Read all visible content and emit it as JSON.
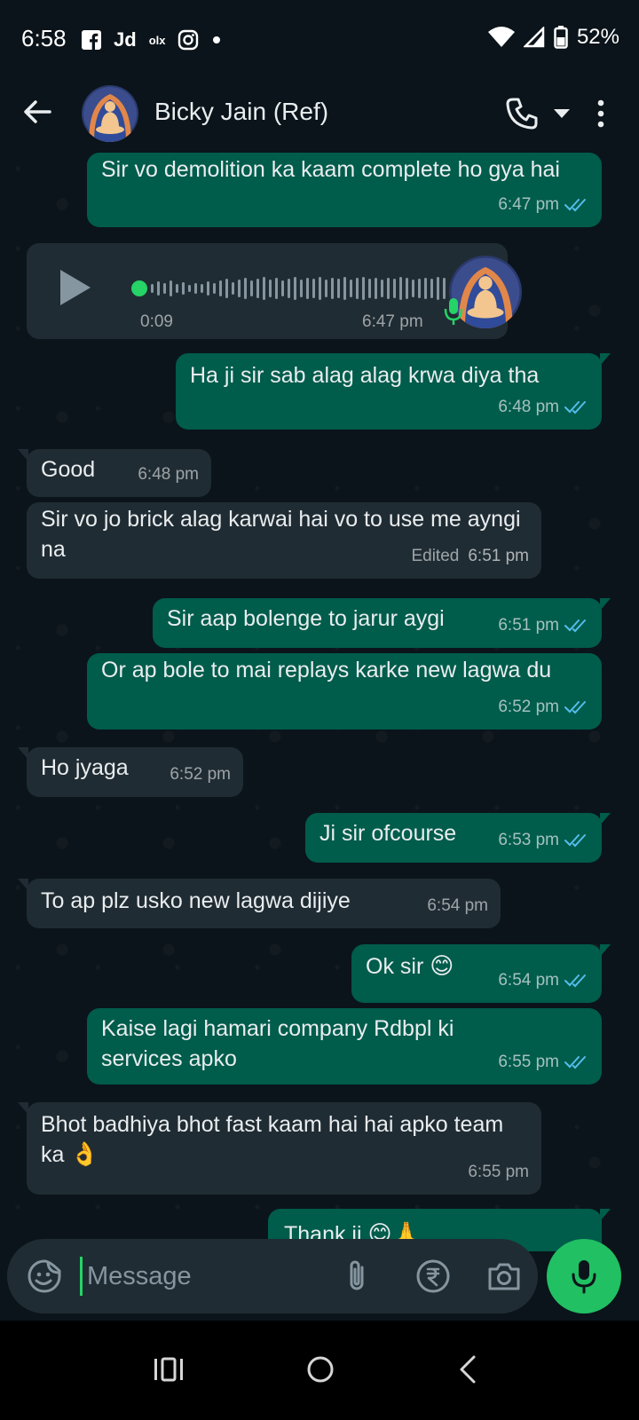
{
  "status_bar": {
    "time": "6:58",
    "app_icons": [
      "facebook-icon",
      "jd-icon",
      "olx-icon",
      "instagram-icon",
      "dot-icon"
    ],
    "jd_label": "Jd",
    "olx_label": "olx",
    "battery": "52%"
  },
  "header": {
    "contact_name": "Bicky Jain (Ref)"
  },
  "messages": [
    {
      "dir": "out",
      "text": "Sir vo demolition ka kaam complete ho gya hai",
      "time": "6:47 pm"
    },
    {
      "dir": "in",
      "type": "voice",
      "duration": "0:09",
      "time": "6:47 pm"
    },
    {
      "dir": "out",
      "text": "Ha ji  sir sab alag alag krwa diya tha",
      "time": "6:48 pm"
    },
    {
      "dir": "in",
      "text": "Good",
      "time": "6:48 pm"
    },
    {
      "dir": "in",
      "text": "Sir vo jo brick alag karwai hai vo to use me ayngi na",
      "edited": "Edited",
      "time": "6:51 pm"
    },
    {
      "dir": "out",
      "text": "Sir aap bolenge to jarur aygi",
      "time": "6:51 pm"
    },
    {
      "dir": "out",
      "text": "Or ap bole to mai replays karke new lagwa du",
      "time": "6:52 pm"
    },
    {
      "dir": "in",
      "text": "Ho jyaga",
      "time": "6:52 pm"
    },
    {
      "dir": "out",
      "text": "Ji sir ofcourse",
      "time": "6:53 pm"
    },
    {
      "dir": "in",
      "text": "To ap plz usko new lagwa dijiye",
      "time": "6:54 pm"
    },
    {
      "dir": "out",
      "text": "Ok sir",
      "emoji": "😊",
      "time": "6:54 pm"
    },
    {
      "dir": "out",
      "text": "Kaise lagi hamari company Rdbpl ki services apko",
      "time": "6:55 pm"
    },
    {
      "dir": "in",
      "text": "Bhot badhiya bhot fast kaam hai hai apko team ka",
      "emoji": "👌",
      "time": "6:55 pm"
    },
    {
      "dir": "out",
      "text": "Thank ji",
      "emoji": "😊🙏",
      "partial": true
    }
  ],
  "input": {
    "placeholder": "Message"
  },
  "colors": {
    "background": "#0b141a",
    "outgoing_bubble": "#005c4b",
    "incoming_bubble": "#202c33",
    "accent": "#21c063",
    "read_tick": "#53bdeb"
  }
}
